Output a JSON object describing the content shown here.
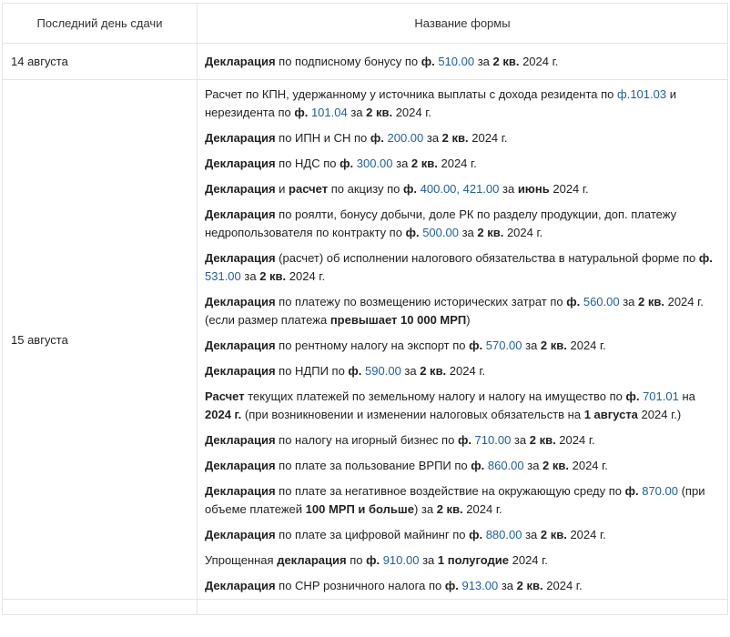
{
  "table": {
    "headers": [
      "Последний день сдачи",
      "Название формы"
    ],
    "rows": [
      {
        "date": "14 августа",
        "items": [
          [
            [
              "Декларация",
              "b"
            ],
            [
              " по подписному бонусу по ",
              ""
            ],
            [
              "ф.",
              "b"
            ],
            [
              " 510.00",
              "f"
            ],
            [
              " за ",
              ""
            ],
            [
              "2 кв.",
              "b"
            ],
            [
              " 2024 г.",
              ""
            ]
          ]
        ]
      },
      {
        "date": "15 августа",
        "items": [
          [
            [
              "Расчет по КПН, удержанному у источника выплаты с дохода резидента по ",
              ""
            ],
            [
              "ф.101.03",
              "f"
            ],
            [
              " и нерезидента по ",
              ""
            ],
            [
              "ф.",
              "b"
            ],
            [
              " 101.04",
              "f"
            ],
            [
              "  за ",
              ""
            ],
            [
              "2 кв.",
              "b"
            ],
            [
              " 2024 г.",
              ""
            ]
          ],
          [
            [
              "Декларация",
              "b"
            ],
            [
              " по ИПН и СН по ",
              ""
            ],
            [
              "ф.",
              "b"
            ],
            [
              " 200.00",
              "f"
            ],
            [
              " за ",
              ""
            ],
            [
              "2 кв.",
              "b"
            ],
            [
              " 2024 г.",
              ""
            ]
          ],
          [
            [
              "Декларация",
              "b"
            ],
            [
              " по НДС по ",
              ""
            ],
            [
              "ф.",
              "b"
            ],
            [
              " 300.00",
              "f"
            ],
            [
              " за ",
              ""
            ],
            [
              "2 кв.",
              "b"
            ],
            [
              " 2024 г.",
              ""
            ]
          ],
          [
            [
              "Декларация",
              "b"
            ],
            [
              " и ",
              ""
            ],
            [
              "расчет",
              "b"
            ],
            [
              " по акцизу по ",
              ""
            ],
            [
              "ф.",
              "b"
            ],
            [
              " 400.00, 421.00",
              "f"
            ],
            [
              "  за ",
              ""
            ],
            [
              "июнь",
              "b"
            ],
            [
              " 2024 г.",
              ""
            ]
          ],
          [
            [
              "Декларация",
              "b"
            ],
            [
              " по роялти, бонусу добычи, доле РК по разделу продукции, доп. платежу недропользователя по контракту по ",
              ""
            ],
            [
              "ф.",
              "b"
            ],
            [
              " 500.00",
              "f"
            ],
            [
              "  за ",
              ""
            ],
            [
              "2 кв.",
              "b"
            ],
            [
              " 2024 г.",
              ""
            ]
          ],
          [
            [
              "Декларация",
              "b"
            ],
            [
              " (расчет) об исполнении налогового обязательства в натуральной форме по ",
              ""
            ],
            [
              "ф.",
              "b"
            ],
            [
              " 531.00",
              "f"
            ],
            [
              " за ",
              ""
            ],
            [
              "2 кв.",
              "b"
            ],
            [
              " 2024 г.",
              ""
            ]
          ],
          [
            [
              "Декларация",
              "b"
            ],
            [
              " по платежу по возмещению исторических затрат по ",
              ""
            ],
            [
              "ф.",
              "b"
            ],
            [
              " 560.00",
              "f"
            ],
            [
              "  за ",
              ""
            ],
            [
              "2 кв.",
              "b"
            ],
            [
              " 2024 г. (если размер платежа ",
              ""
            ],
            [
              "превышает 10 000 МРП",
              "b"
            ],
            [
              ")",
              ""
            ]
          ],
          [
            [
              "Декларация",
              "b"
            ],
            [
              " по рентному налогу на экспорт по ",
              ""
            ],
            [
              "ф.",
              "b"
            ],
            [
              " 570.00",
              "f"
            ],
            [
              " за ",
              ""
            ],
            [
              "2 кв.",
              "b"
            ],
            [
              " 2024 г.",
              ""
            ]
          ],
          [
            [
              "Декларация",
              "b"
            ],
            [
              " по НДПИ по ",
              ""
            ],
            [
              "ф.",
              "b"
            ],
            [
              " 590.00",
              "f"
            ],
            [
              " за ",
              ""
            ],
            [
              "2 кв.",
              "b"
            ],
            [
              " 2024 г.",
              ""
            ]
          ],
          [
            [
              "Расчет",
              "b"
            ],
            [
              " текущих платежей по земельному налогу и налогу на имущество по ",
              ""
            ],
            [
              "ф.",
              "b"
            ],
            [
              " 701.01",
              "f"
            ],
            [
              " на ",
              ""
            ],
            [
              "2024 г.",
              "b"
            ],
            [
              " (при возникновении и изменении налоговых обязательств на ",
              ""
            ],
            [
              "1 августа",
              "b"
            ],
            [
              " 2024 г.)",
              ""
            ]
          ],
          [
            [
              "Декларация",
              "b"
            ],
            [
              " по налогу на игорный бизнес по ",
              ""
            ],
            [
              "ф.",
              "b"
            ],
            [
              " 710.00",
              "f"
            ],
            [
              " за ",
              ""
            ],
            [
              "2 кв.",
              "b"
            ],
            [
              " 2024 г.",
              ""
            ]
          ],
          [
            [
              "Декларация",
              "b"
            ],
            [
              " по плате за пользование ВРПИ по ",
              ""
            ],
            [
              "ф.",
              "b"
            ],
            [
              " 860.00",
              "f"
            ],
            [
              "  за ",
              ""
            ],
            [
              "2 кв.",
              "b"
            ],
            [
              " 2024 г.",
              ""
            ]
          ],
          [
            [
              "Декларация",
              "b"
            ],
            [
              " по плате за негативное воздействие на окружающую среду по ",
              ""
            ],
            [
              "ф.",
              "b"
            ],
            [
              " 870.00",
              "f"
            ],
            [
              " (при объеме платежей ",
              ""
            ],
            [
              "100 МРП и больше",
              "b"
            ],
            [
              ") за ",
              ""
            ],
            [
              "2 кв.",
              "b"
            ],
            [
              " 2024 г.",
              ""
            ]
          ],
          [
            [
              "Декларация",
              "b"
            ],
            [
              " по плате за цифровой майнинг по ",
              ""
            ],
            [
              "ф.",
              "b"
            ],
            [
              " 880.00",
              "f"
            ],
            [
              " за ",
              ""
            ],
            [
              "2 кв.",
              "b"
            ],
            [
              " 2024 г.",
              ""
            ]
          ],
          [
            [
              "Упрощенная ",
              ""
            ],
            [
              "декларация",
              "b"
            ],
            [
              " по ",
              ""
            ],
            [
              "ф.",
              "b"
            ],
            [
              " 910.00",
              "f"
            ],
            [
              "  за ",
              ""
            ],
            [
              "1 полугодие",
              "b"
            ],
            [
              " 2024 г.",
              ""
            ]
          ],
          [
            [
              "Декларация",
              "b"
            ],
            [
              " по СНР розничного налога по ",
              ""
            ],
            [
              "ф.",
              "b"
            ],
            [
              " 913.00",
              "f"
            ],
            [
              " за ",
              ""
            ],
            [
              "2",
              "b"
            ],
            [
              "  ",
              ""
            ],
            [
              "кв.",
              "b"
            ],
            [
              " 2024 г.",
              ""
            ]
          ]
        ]
      }
    ]
  }
}
